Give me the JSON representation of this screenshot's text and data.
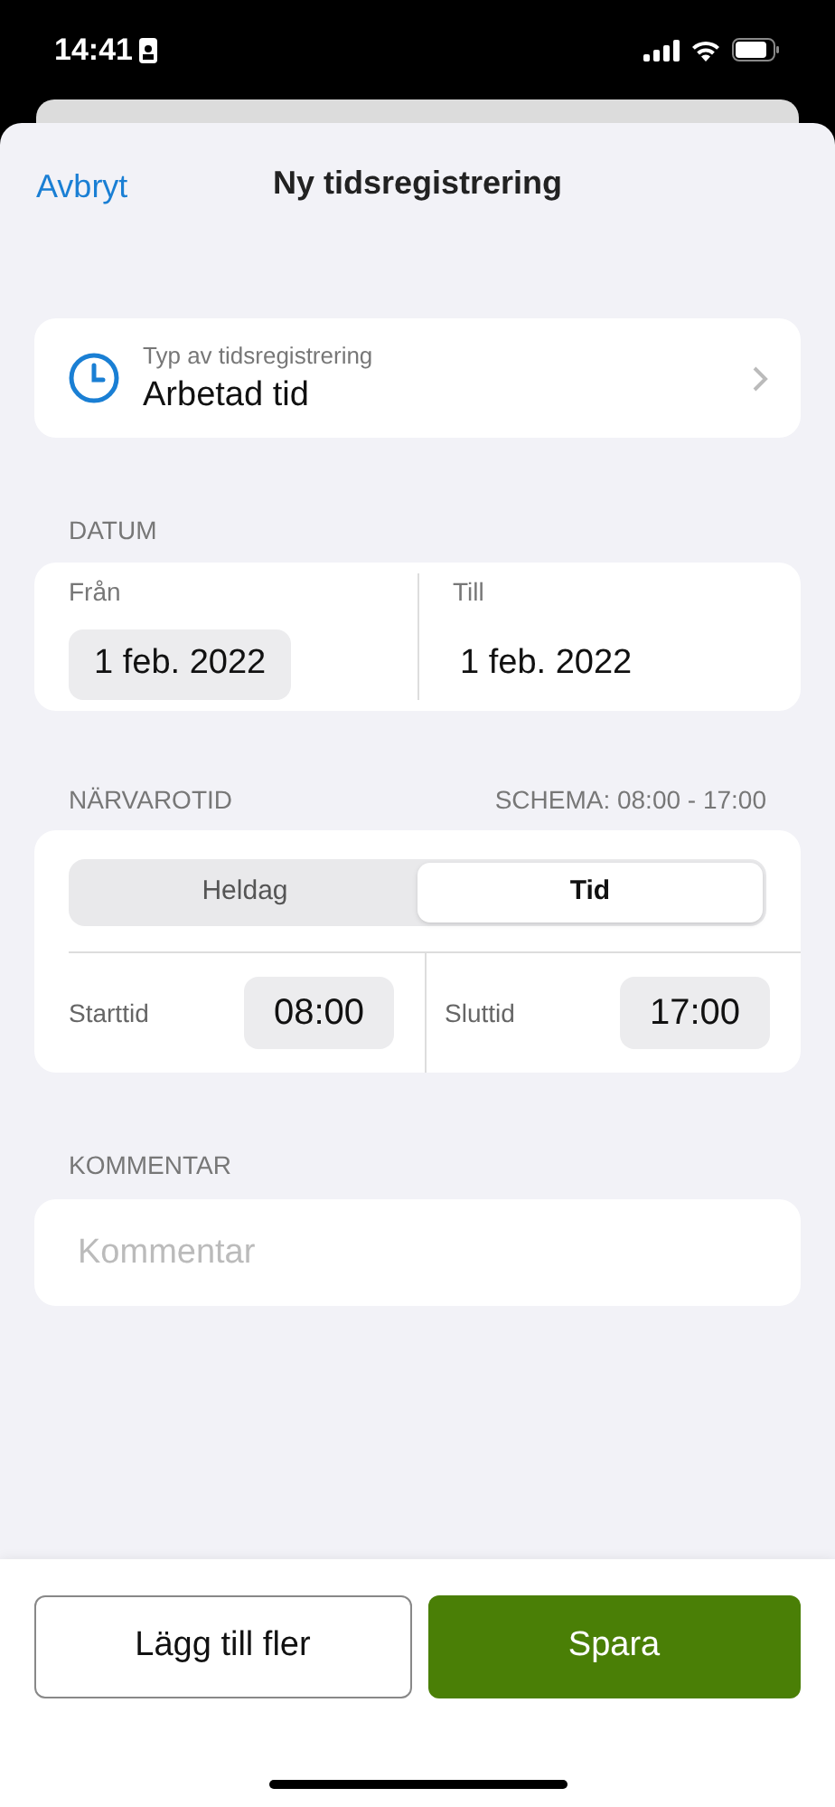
{
  "status_bar": {
    "time": "14:41"
  },
  "header": {
    "cancel": "Avbryt",
    "title": "Ny tidsregistrering"
  },
  "type_row": {
    "label": "Typ av tidsregistrering",
    "value": "Arbetad tid"
  },
  "date_section": {
    "heading": "DATUM",
    "fields": [
      {
        "label": "Från",
        "value": "1 feb. 2022",
        "selected": true
      },
      {
        "label": "Till",
        "value": "1 feb. 2022",
        "selected": false
      }
    ]
  },
  "attendance_section": {
    "heading": "NÄRVAROTID",
    "schedule": "SCHEMA: 08:00 - 17:00",
    "segments": [
      {
        "label": "Heldag",
        "selected": false
      },
      {
        "label": "Tid",
        "selected": true
      }
    ],
    "times": [
      {
        "label": "Starttid",
        "value": "08:00"
      },
      {
        "label": "Sluttid",
        "value": "17:00"
      }
    ]
  },
  "comment_section": {
    "heading": "KOMMENTAR",
    "placeholder": "Kommentar"
  },
  "buttons": [
    {
      "label": "Lägg till fler",
      "kind": "secondary"
    },
    {
      "label": "Spara",
      "kind": "primary"
    }
  ]
}
